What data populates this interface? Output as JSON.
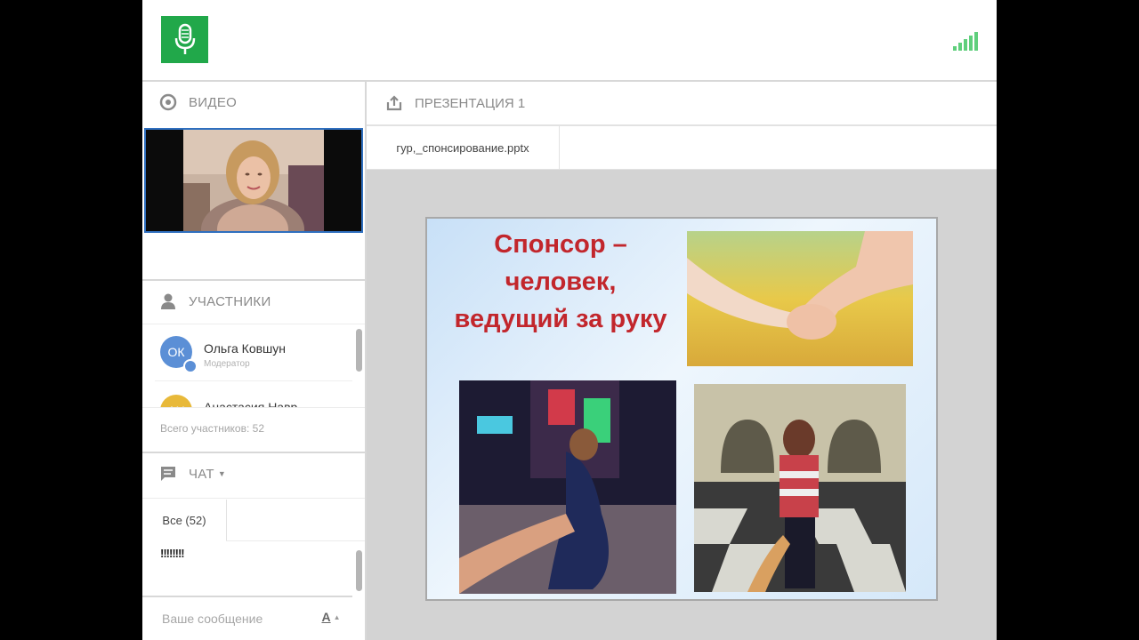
{
  "header": {
    "logo_icon": "microphone-icon",
    "signal_icon": "signal-bars-icon",
    "brand_color": "#21a84a",
    "signal_color": "#5fcf7c"
  },
  "video": {
    "title": "ВИДЕО",
    "icon": "camera-icon"
  },
  "participants": {
    "title": "УЧАСТНИКИ",
    "icon": "user-icon",
    "items": [
      {
        "initials": "ОК",
        "name": "Ольга Ковшун",
        "role": "Модератор",
        "avatar_color": "#5b8fd6"
      },
      {
        "initials": "АН",
        "name": "Анастасия Навр",
        "role": "",
        "avatar_color": "#e8b93a"
      }
    ],
    "total": "Всего участников: 52"
  },
  "chat": {
    "title": "ЧАТ",
    "icon": "chat-icon",
    "tab_label": "Все (52)",
    "message": "!!!!!!!!",
    "placeholder": "Ваше сообщение",
    "font_button": "A"
  },
  "presentation": {
    "title": "ПРЕЗЕНТАЦИЯ 1",
    "icon": "upload-icon",
    "tab_label": "гур,_спонсирование.pptx",
    "slide_title": "Спонсор – человек, ведущий за руку",
    "title_color": "#c2262c"
  }
}
